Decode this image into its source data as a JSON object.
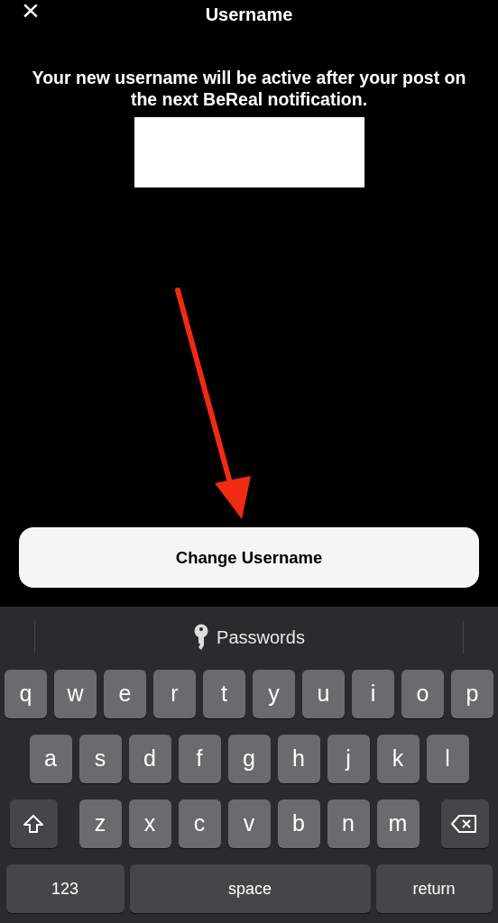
{
  "header": {
    "close": "×",
    "title": "Username"
  },
  "message": "Your new username will be active after your post on the next BeReal notification.",
  "button": "Change Username",
  "keyboard": {
    "suggestion": "Passwords",
    "rows": [
      {
        "keys": [
          {
            "kind": "letter",
            "label": "q"
          },
          {
            "kind": "letter",
            "label": "w"
          },
          {
            "kind": "letter",
            "label": "e"
          },
          {
            "kind": "letter",
            "label": "r"
          },
          {
            "kind": "letter",
            "label": "t"
          },
          {
            "kind": "letter",
            "label": "y"
          },
          {
            "kind": "letter",
            "label": "u"
          },
          {
            "kind": "letter",
            "label": "i"
          },
          {
            "kind": "letter",
            "label": "o"
          },
          {
            "kind": "letter",
            "label": "p"
          }
        ]
      },
      {
        "keys": [
          {
            "kind": "letter",
            "label": "a"
          },
          {
            "kind": "letter",
            "label": "s"
          },
          {
            "kind": "letter",
            "label": "d"
          },
          {
            "kind": "letter",
            "label": "f"
          },
          {
            "kind": "letter",
            "label": "g"
          },
          {
            "kind": "letter",
            "label": "h"
          },
          {
            "kind": "letter",
            "label": "j"
          },
          {
            "kind": "letter",
            "label": "k"
          },
          {
            "kind": "letter",
            "label": "l"
          }
        ]
      },
      {
        "keys": [
          {
            "kind": "shift"
          },
          {
            "kind": "letter",
            "label": "z"
          },
          {
            "kind": "letter",
            "label": "x"
          },
          {
            "kind": "letter",
            "label": "c"
          },
          {
            "kind": "letter",
            "label": "v"
          },
          {
            "kind": "letter",
            "label": "b"
          },
          {
            "kind": "letter",
            "label": "n"
          },
          {
            "kind": "letter",
            "label": "m"
          },
          {
            "kind": "delete"
          }
        ]
      },
      {
        "keys": [
          {
            "kind": "mode",
            "label": "123"
          },
          {
            "kind": "space",
            "label": "space"
          },
          {
            "kind": "return",
            "label": "return"
          }
        ]
      }
    ]
  }
}
